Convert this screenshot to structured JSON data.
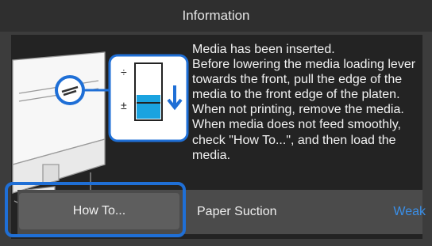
{
  "header": {
    "title": "Information"
  },
  "message": {
    "text": "Media has been inserted.\nBefore lowering the media loading lever towards the front, pull the edge of the media to the front edge of the platen.\nWhen not printing, remove the media.\nWhen media does not feed smoothly, check \"How To...\", and then load the media."
  },
  "buttons": {
    "how_to_label": "How To..."
  },
  "setting": {
    "label": "Paper Suction",
    "value": "Weak"
  },
  "colors": {
    "accent": "#1f6fd6",
    "value_text": "#3a8fe8",
    "level_fill": "#1aa3e0"
  }
}
